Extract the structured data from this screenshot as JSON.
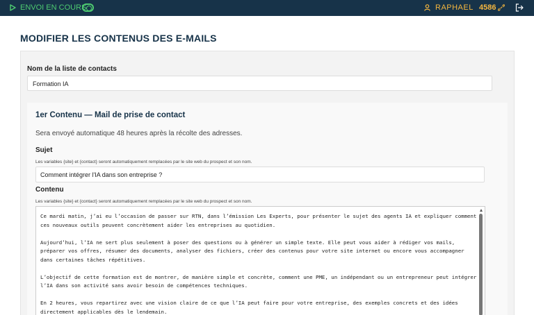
{
  "topbar": {
    "status_label": "ENVOI EN COURS",
    "status_color": "#4ecb71",
    "user_name": "RAPHAEL",
    "credits": "4586",
    "icons": [
      "play-icon",
      "toggle-icon",
      "user-icon",
      "link-icon",
      "logout-icon"
    ]
  },
  "page": {
    "title": "MODIFIER LES CONTENUS DES E-MAILS"
  },
  "list": {
    "label": "Nom de la liste de contacts",
    "value": "Formation IA"
  },
  "content1": {
    "title": "1er Contenu — Mail de prise de contact",
    "description": "Sera envoyé automatique 48 heures après la récolte des adresses.",
    "subject_label": "Sujet",
    "subject_hint": "Les variables {site} et {contact} seront automatiquement remplacées par le site web du prospect et son nom.",
    "subject_value": "Comment intégrer l'IA dans son entreprise ?",
    "content_label": "Contenu",
    "content_hint": "Les variables {site} et {contact} seront automatiquement remplacées par le site web du prospect et son nom.",
    "body": [
      "Ce mardi matin, j’ai eu l’occasion de passer sur RTN, dans l’émission Les Experts, pour présenter le sujet des agents IA et expliquer comment ces nouveaux outils peuvent concrètement aider les entreprises au quotidien.",
      "Aujourd’hui, l’IA ne sert plus seulement à poser des questions ou à générer un simple texte. Elle peut vous aider à rédiger vos mails, préparer vos offres, résumer des documents, analyser des fichiers, créer des contenus pour votre site internet ou encore vous accompagner dans certaines tâches répétitives.",
      "L’objectif de cette formation est de montrer, de manière simple et concrète, comment une PME, un indépendant ou un entrepreneur peut intégrer l’IA dans son activité sans avoir besoin de compétences techniques.",
      "En 2 heures, vous repartirez avec une vision claire de ce que l’IA peut faire pour votre entreprise, des exemples concrets et des idées directement applicables dès le lendemain."
    ]
  },
  "colors": {
    "topbar": "#173349",
    "accent_green": "#4ecb71",
    "accent_orange": "#f4b63f",
    "title_navy": "#173349"
  }
}
